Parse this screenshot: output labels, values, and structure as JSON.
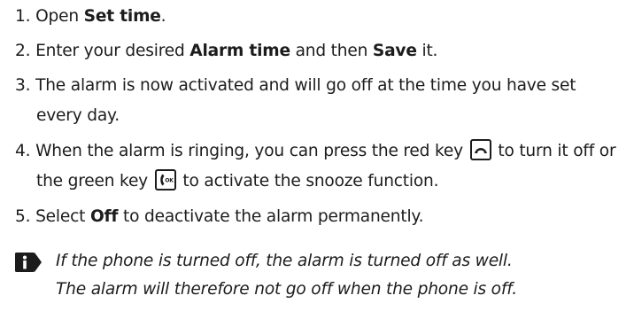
{
  "steps": [
    {
      "number": "1.",
      "parts": [
        "Open ",
        "Set time",
        "."
      ]
    },
    {
      "number": "2.",
      "parts": [
        "Enter your desired ",
        "Alarm time",
        " and then ",
        "Save",
        " it."
      ]
    },
    {
      "number": "3.",
      "text": "The alarm is now activated and will go off at the time you have set every day."
    },
    {
      "number": "4.",
      "parts": [
        "When the alarm is ringing, you can press the red key ",
        " to turn it off or the green key ",
        " to activate the snooze function."
      ],
      "icons": [
        "end-call-key-icon",
        "ok-call-key-icon"
      ],
      "ok_key_label": "OK"
    },
    {
      "number": "5.",
      "parts": [
        "Select ",
        "Off",
        " to deactivate the alarm permanently."
      ]
    }
  ],
  "note": {
    "icon": "info-icon",
    "lines": [
      "If the phone is turned off, the alarm is turned off as well.",
      "The alarm will therefore not go off when the phone is off."
    ]
  }
}
